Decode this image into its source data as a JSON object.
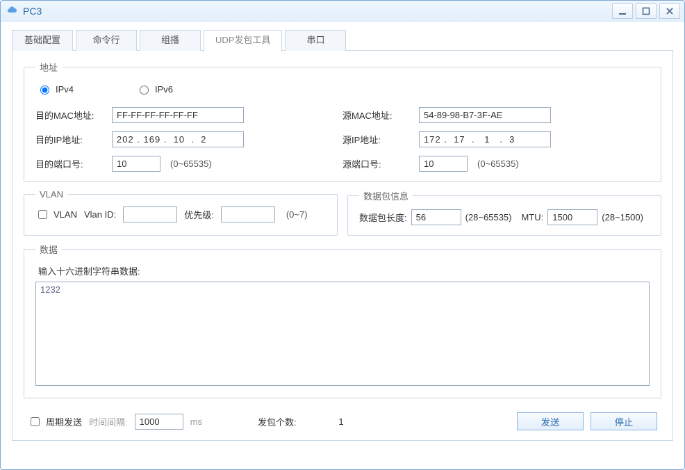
{
  "window": {
    "title": "PC3"
  },
  "tabs": [
    "基础配置",
    "命令行",
    "组播",
    "UDP发包工具",
    "串口"
  ],
  "active_tab_index": 3,
  "address": {
    "legend": "地址",
    "ipv4": "IPv4",
    "ipv6": "IPv6",
    "ip_version_selected": "IPv4",
    "dest_mac_label": "目的MAC地址:",
    "dest_mac_value": "FF-FF-FF-FF-FF-FF",
    "src_mac_label": "源MAC地址:",
    "src_mac_value": "54-89-98-B7-3F-AE",
    "dest_ip_label": "目的IP地址:",
    "dest_ip_value": "202 . 169 .  10  .  2",
    "src_ip_label": "源IP地址:",
    "src_ip_value": "172 .  17  .   1   .  3",
    "dest_port_label": "目的端口号:",
    "dest_port_value": "10",
    "src_port_label": "源端口号:",
    "src_port_value": "10",
    "port_range_hint": "(0~65535)"
  },
  "vlan": {
    "legend": "VLAN",
    "checkbox_label": "VLAN",
    "checked": false,
    "vlan_id_label": "Vlan ID:",
    "vlan_id_value": "",
    "priority_label": "优先级:",
    "priority_value": "",
    "priority_hint": "(0~7)"
  },
  "packet": {
    "legend": "数据包信息",
    "length_label": "数据包长度:",
    "length_value": "56",
    "length_hint": "(28~65535)",
    "mtu_label": "MTU:",
    "mtu_value": "1500",
    "mtu_hint": "(28~1500)"
  },
  "data": {
    "legend": "数据",
    "hint": "输入十六进制字符串数据:",
    "value": "1232"
  },
  "footer": {
    "periodic_label": "周期发送",
    "periodic_checked": false,
    "interval_label": "时间间隔:",
    "interval_value": "1000",
    "interval_unit": "ms",
    "count_label": "发包个数:",
    "count_value": "1",
    "send_label": "发送",
    "stop_label": "停止"
  }
}
